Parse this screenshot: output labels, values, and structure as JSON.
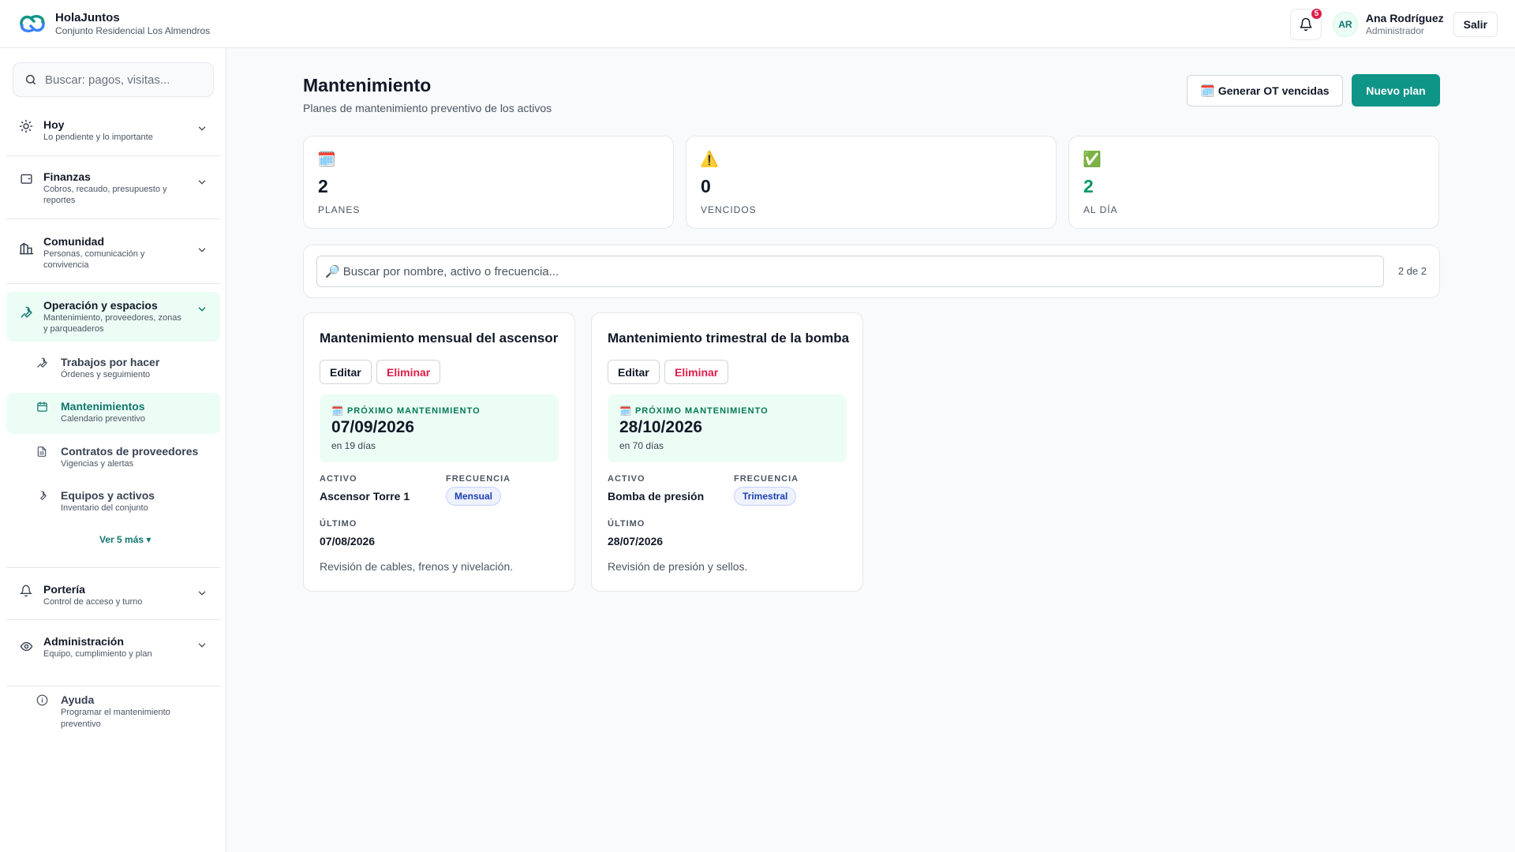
{
  "brand": {
    "name": "HolaJuntos",
    "sub": "Conjunto Residencial Los Almendros"
  },
  "header": {
    "notifications": "5",
    "avatar_initials": "AR",
    "user_name": "Ana Rodríguez",
    "user_role": "Administrador",
    "logout": "Salir"
  },
  "sidebar": {
    "search_placeholder": "Buscar: pagos, visitas...",
    "groups": [
      {
        "title": "Hoy",
        "desc": "Lo pendiente y lo importante"
      },
      {
        "title": "Finanzas",
        "desc": "Cobros, recaudo, presupuesto y reportes"
      },
      {
        "title": "Comunidad",
        "desc": "Personas, comunicación y convivencia"
      },
      {
        "title": "Operación y espacios",
        "desc": "Mantenimiento, proveedores, zonas y parqueaderos"
      },
      {
        "title": "Portería",
        "desc": "Control de acceso y turno"
      },
      {
        "title": "Administración",
        "desc": "Equipo, cumplimiento y plan"
      }
    ],
    "sub_items": [
      {
        "title": "Trabajos por hacer",
        "desc": "Órdenes y seguimiento"
      },
      {
        "title": "Mantenimientos",
        "desc": "Calendario preventivo"
      },
      {
        "title": "Contratos de proveedores",
        "desc": "Vigencias y alertas"
      },
      {
        "title": "Equipos y activos",
        "desc": "Inventario del conjunto"
      }
    ],
    "see_more": "Ver 5 más ▾",
    "help": {
      "title": "Ayuda",
      "desc": "Programar el mantenimiento preventivo"
    }
  },
  "page": {
    "title": "Mantenimiento",
    "subtitle": "Planes de mantenimiento preventivo de los activos",
    "btn_generate": "Generar OT vencidas",
    "btn_new": "Nuevo plan"
  },
  "stats": [
    {
      "icon": "🗓️",
      "value": "2",
      "label": "PLANES",
      "color": "#111827"
    },
    {
      "icon": "⚠️",
      "value": "0",
      "label": "VENCIDOS",
      "color": "#111827"
    },
    {
      "icon": "✅",
      "value": "2",
      "label": "AL DÍA",
      "color": "#059669"
    }
  ],
  "filter": {
    "placeholder": "Buscar por nombre, activo o frecuencia...",
    "count": "2 de 2"
  },
  "cards": [
    {
      "title": "Mantenimiento mensual del ascensor",
      "edit": "Editar",
      "delete": "Eliminar",
      "next_label": "PRÓXIMO MANTENIMIENTO",
      "next_date": "07/09/2026",
      "next_rel": "en 19 días",
      "asset_label": "ACTIVO",
      "asset": "Ascensor Torre 1",
      "freq_label": "FRECUENCIA",
      "freq": "Mensual",
      "last_label": "ÚLTIMO",
      "last": "07/08/2026",
      "desc": "Revisión de cables, frenos y nivelación."
    },
    {
      "title": "Mantenimiento trimestral de la bomba",
      "edit": "Editar",
      "delete": "Eliminar",
      "next_label": "PRÓXIMO MANTENIMIENTO",
      "next_date": "28/10/2026",
      "next_rel": "en 70 días",
      "asset_label": "ACTIVO",
      "asset": "Bomba de presión",
      "freq_label": "FRECUENCIA",
      "freq": "Trimestral",
      "last_label": "ÚLTIMO",
      "last": "28/07/2026",
      "desc": "Revisión de presión y sellos."
    }
  ],
  "colors": {
    "accent": "#0f9488",
    "accent_soft": "#ecfdf5",
    "danger": "#e11d48"
  }
}
